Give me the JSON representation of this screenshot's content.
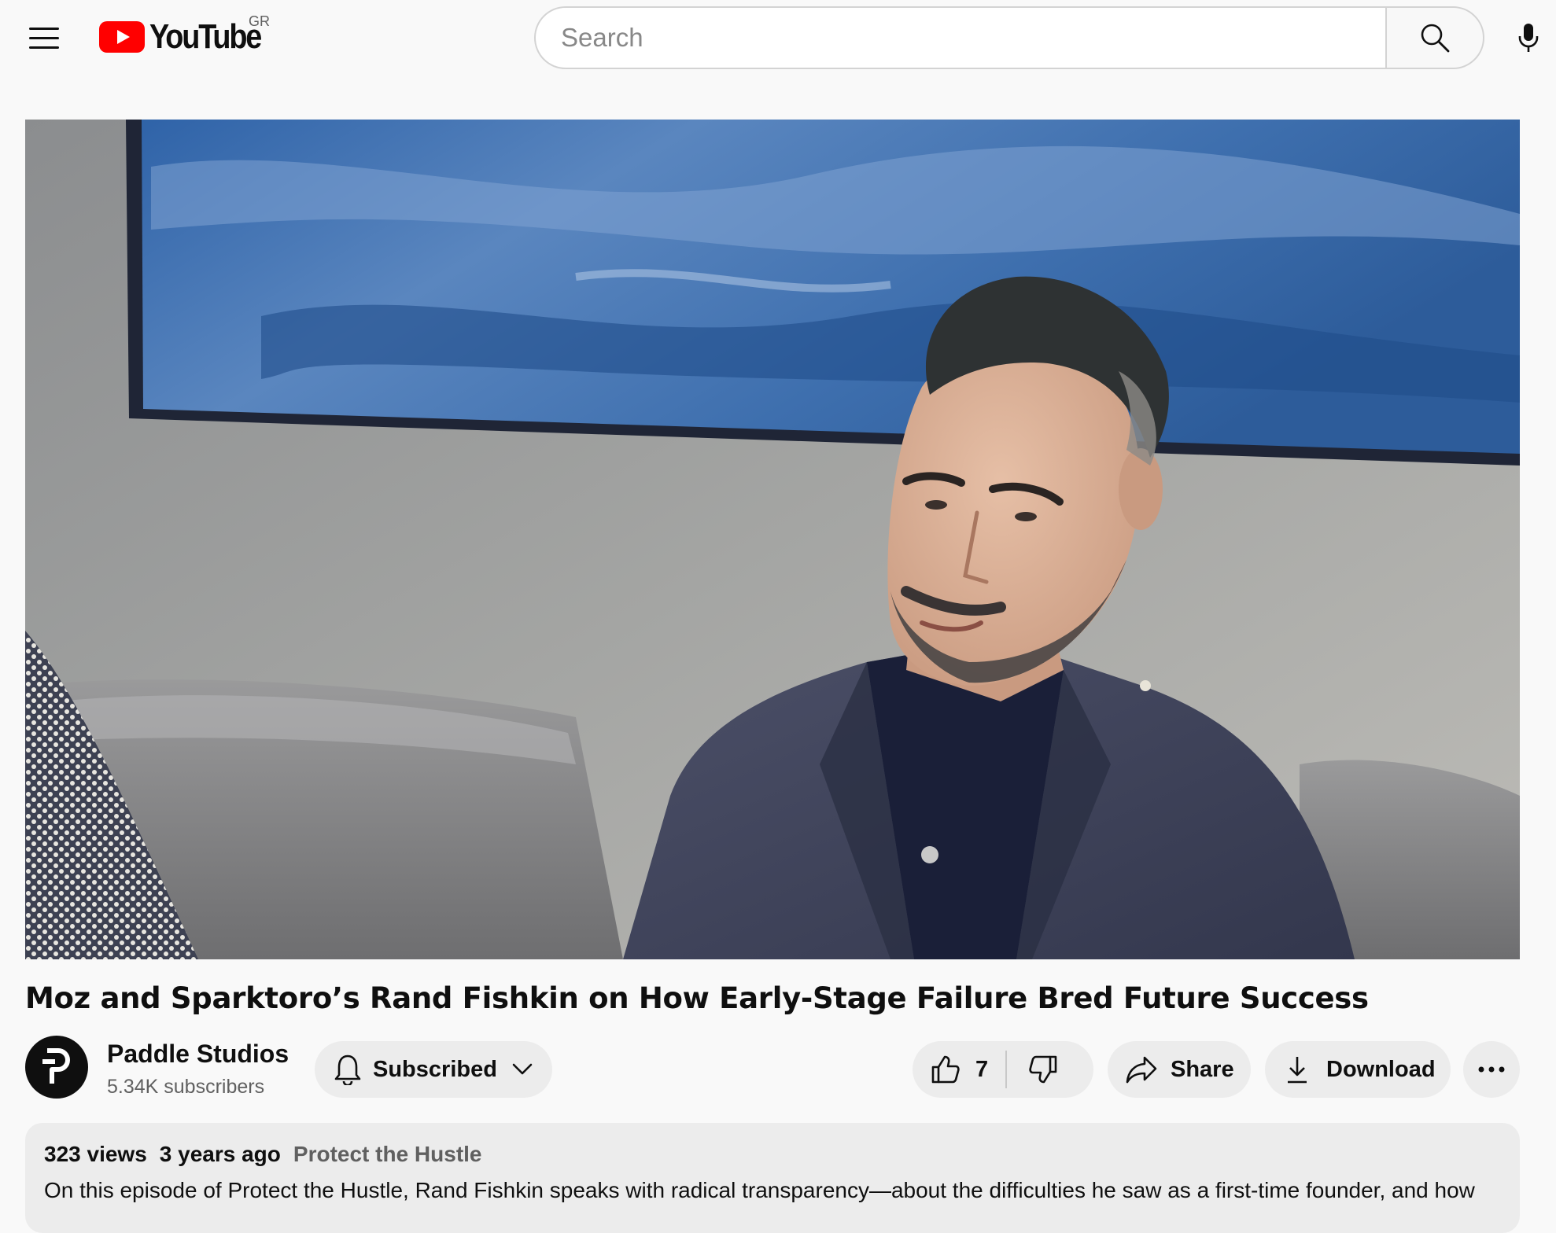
{
  "masthead": {
    "logo_text": "YouTube",
    "region": "GR",
    "search_placeholder": "Search",
    "icons": [
      "menu-icon",
      "youtube-logo-icon",
      "search-icon",
      "microphone-icon"
    ],
    "brand_color": "#FF0000"
  },
  "video": {
    "title": "Moz and Sparktoro’s Rand Fishkin on How Early-Stage Failure Bred Future Success"
  },
  "channel": {
    "name": "Paddle Studios",
    "subscribers": "5.34K subscribers",
    "avatar_letter": "P"
  },
  "actions": {
    "subscribed_label": "Subscribed",
    "like_count": "7",
    "share_label": "Share",
    "download_label": "Download",
    "icons": [
      "bell-icon",
      "chevron-down-icon",
      "thumbs-up-icon",
      "thumbs-down-icon",
      "share-arrow-icon",
      "download-icon",
      "more-horizontal-icon"
    ]
  },
  "description": {
    "views": "323 views",
    "age": "3 years ago",
    "playlist": "Protect the Hustle",
    "text": "On this episode of Protect the Hustle, Rand Fishkin speaks with radical transparency—about the difficulties he saw as a first-time founder, and how"
  }
}
